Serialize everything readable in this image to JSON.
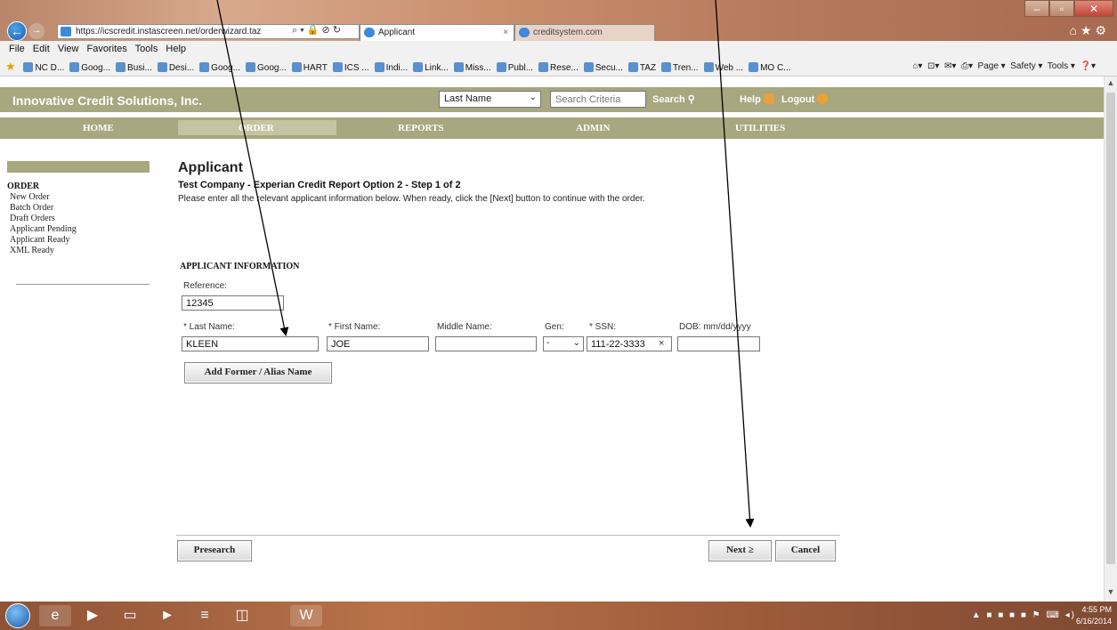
{
  "browser": {
    "address_url": "https://icscredit.instascreen.net/orderwizard.taz",
    "tabs": [
      {
        "label": "Applicant",
        "active": true
      },
      {
        "label": "creditsystem.com",
        "active": false
      }
    ],
    "menu": [
      "File",
      "Edit",
      "View",
      "Favorites",
      "Tools",
      "Help"
    ],
    "favorites": [
      "NC D...",
      "Goog...",
      "Busi...",
      "Desi...",
      "Goog...",
      "Goog...",
      "HART",
      "ICS ...",
      "Indi...",
      "Link...",
      "Miss...",
      "Publ...",
      "Rese...",
      "Secu...",
      "TAZ",
      "Tren...",
      "Web ...",
      "MO C..."
    ],
    "command_bar": [
      "Page ▾",
      "Safety ▾",
      "Tools ▾"
    ]
  },
  "header": {
    "brand": "Innovative Credit Solutions, Inc.",
    "search_field": "Last Name",
    "search_placeholder": "Search Criteria",
    "search_label": "Search",
    "help_label": "Help",
    "logout_label": "Logout"
  },
  "nav": [
    "HOME",
    "ORDER",
    "REPORTS",
    "ADMIN",
    "UTILITIES"
  ],
  "sidebar": {
    "title": "ORDER",
    "items": [
      "New Order",
      "Batch Order",
      "Draft Orders",
      "Applicant Pending",
      "Applicant Ready",
      "XML Ready"
    ]
  },
  "main": {
    "title": "Applicant",
    "subtitle": "Test Company - Experian Credit Report Option 2 - Step 1 of 2",
    "instructions": "Please enter all the relevant applicant information below. When ready, click the [Next] button to continue with the order.",
    "section_title": "APPLICANT INFORMATION",
    "reference_label": "Reference:",
    "reference_value": "12345",
    "last_name_label": "* Last Name:",
    "last_name_value": "KLEEN",
    "first_name_label": "* First Name:",
    "first_name_value": "JOE",
    "middle_name_label": "Middle Name:",
    "middle_name_value": "",
    "gen_label": "Gen:",
    "gen_value": "-",
    "ssn_label": "* SSN:",
    "ssn_value": "111-22-3333",
    "dob_label": "DOB: mm/dd/yyyy",
    "dob_value": "",
    "alias_button": "Add Former / Alias Name",
    "presearch_button": "Presearch",
    "next_button": "Next ≥",
    "cancel_button": "Cancel"
  },
  "taskbar": {
    "time": "4:55 PM",
    "date": "6/16/2014"
  }
}
